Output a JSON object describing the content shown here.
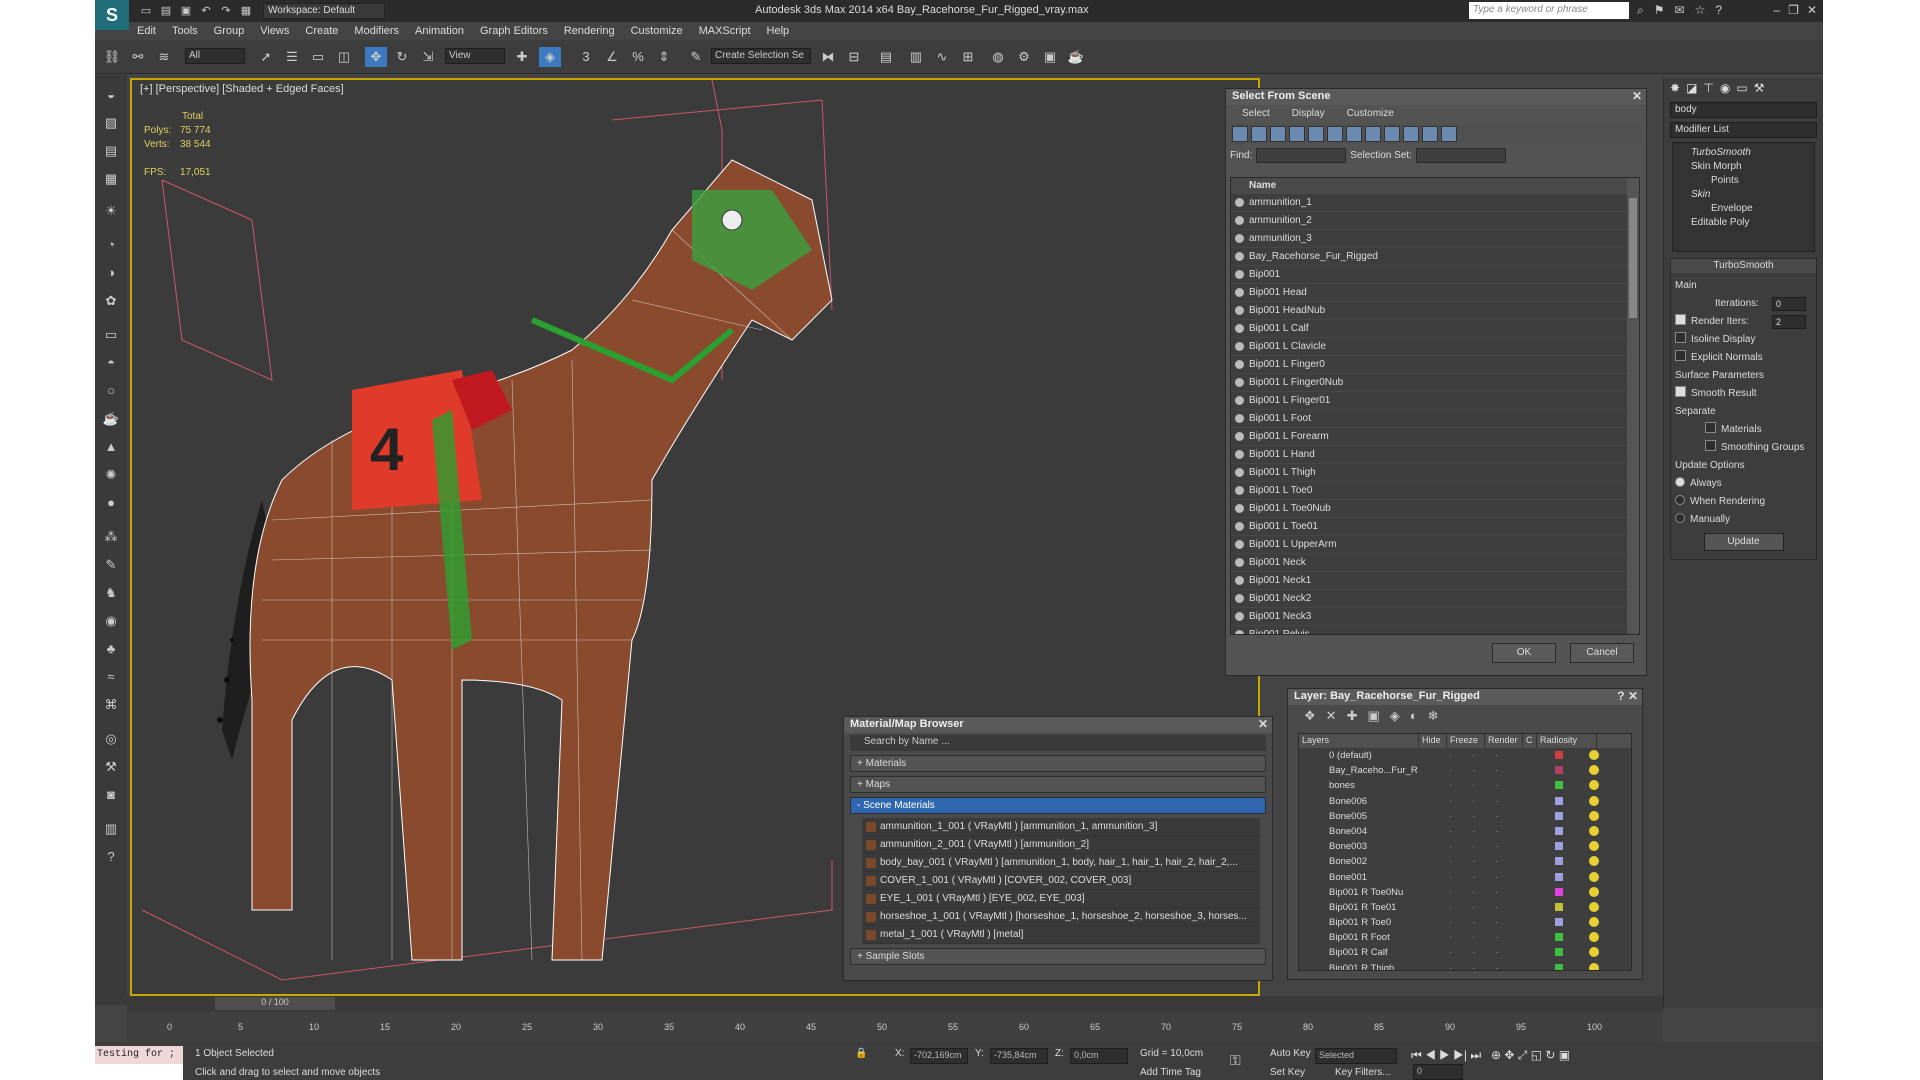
{
  "window": {
    "title": "Autodesk 3ds Max  2014 x64    Bay_Racehorse_Fur_Rigged_vray.max",
    "workspace": "Workspace: Default",
    "search_placeholder": "Type a keyword or phrase"
  },
  "menu": [
    "Edit",
    "Tools",
    "Group",
    "Views",
    "Create",
    "Modifiers",
    "Animation",
    "Graph Editors",
    "Rendering",
    "Customize",
    "MAXScript",
    "Help"
  ],
  "toolbar": {
    "filter": "All",
    "view": "View",
    "selset": "Create Selection Se"
  },
  "viewport": {
    "label": "[+] [Perspective] [Shaded + Edged Faces]",
    "stats": {
      "total": "Total",
      "polys_label": "Polys:",
      "polys": "75 774",
      "verts_label": "Verts:",
      "verts": "38 544",
      "fps_label": "FPS:",
      "fps": "17,051"
    },
    "number": "4"
  },
  "sfs": {
    "title": "Select From Scene",
    "menu": [
      "Select",
      "Display",
      "Customize"
    ],
    "find": "Find:",
    "selset": "Selection Set:",
    "col": "Name",
    "items": [
      "ammunition_1",
      "ammunition_2",
      "ammunition_3",
      "Bay_Racehorse_Fur_Rigged",
      "Bip001",
      "Bip001 Head",
      "Bip001 HeadNub",
      "Bip001 L Calf",
      "Bip001 L Clavicle",
      "Bip001 L Finger0",
      "Bip001 L Finger0Nub",
      "Bip001 L Finger01",
      "Bip001 L Foot",
      "Bip001 L Forearm",
      "Bip001 L Hand",
      "Bip001 L Thigh",
      "Bip001 L Toe0",
      "Bip001 L Toe0Nub",
      "Bip001 L Toe01",
      "Bip001 L UpperArm",
      "Bip001 Neck",
      "Bip001 Neck1",
      "Bip001 Neck2",
      "Bip001 Neck3",
      "Bip001 Pelvis"
    ],
    "ok": "OK",
    "cancel": "Cancel"
  },
  "mmb": {
    "title": "Material/Map Browser",
    "search": "Search by Name ...",
    "sections": [
      "+ Materials",
      "+ Maps",
      "- Scene Materials"
    ],
    "materials": [
      "ammunition_1_001  ( VRayMtl ) [ammunition_1, ammunition_3]",
      "ammunition_2_001  ( VRayMtl ) [ammunition_2]",
      "body_bay_001  ( VRayMtl ) [ammunition_1, body, hair_1, hair_1, hair_2, hair_2,...",
      "COVER_1_001  ( VRayMtl ) [COVER_002, COVER_003]",
      "EYE_1_001  ( VRayMtl ) [EYE_002, EYE_003]",
      "horseshoe_1_001  ( VRayMtl ) [horseshoe_1, horseshoe_2, horseshoe_3, horses...",
      "metal_1_001  ( VRayMtl ) [metal]"
    ],
    "sample": "+ Sample Slots"
  },
  "layer": {
    "title": "Layer: Bay_Racehorse_Fur_Rigged",
    "cols": [
      "Layers",
      "Hide",
      "Freeze",
      "Render",
      "C",
      "Radiosity"
    ],
    "rows": [
      {
        "n": "0 (default)",
        "c": "#d04040"
      },
      {
        "n": "Bay_Raceho...Fur_R",
        "c": "#b04060"
      },
      {
        "n": "bones",
        "c": "#40c040"
      },
      {
        "n": "Bone006",
        "c": "#a0a0e0"
      },
      {
        "n": "Bone005",
        "c": "#a0a0e0"
      },
      {
        "n": "Bone004",
        "c": "#a0a0e0"
      },
      {
        "n": "Bone003",
        "c": "#a0a0e0"
      },
      {
        "n": "Bone002",
        "c": "#a0a0e0"
      },
      {
        "n": "Bone001",
        "c": "#a0a0e0"
      },
      {
        "n": "Bip001 R Toe0Nu",
        "c": "#e040e0"
      },
      {
        "n": "Bip001 R Toe01",
        "c": "#c0c040"
      },
      {
        "n": "Bip001 R Toe0",
        "c": "#a0a0e0"
      },
      {
        "n": "Bip001 R Foot",
        "c": "#40c040"
      },
      {
        "n": "Bip001 R Calf",
        "c": "#40c040"
      },
      {
        "n": "Bip001 R Thigh",
        "c": "#40c040"
      }
    ]
  },
  "cmd": {
    "name": "body",
    "modlist": "Modifier List",
    "stack": [
      "TurboSmooth",
      "Skin Morph",
      "Points",
      "Skin",
      "Envelope",
      "Editable Poly"
    ],
    "ts": "TurboSmooth",
    "main": "Main",
    "iter_label": "Iterations:",
    "iter": "0",
    "render_label": "Render Iters:",
    "render": "2",
    "isoline": "Isoline Display",
    "explicit": "Explicit Normals",
    "surface": "Surface Parameters",
    "smooth": "Smooth Result",
    "separate": "Separate",
    "materials": "Materials",
    "groups": "Smoothing Groups",
    "upd": "Update Options",
    "always": "Always",
    "whenr": "When Rendering",
    "manual": "Manually",
    "update": "Update"
  },
  "time": {
    "frame": "0 / 100",
    "ticks": [
      "0",
      "5",
      "10",
      "15",
      "20",
      "25",
      "30",
      "35",
      "40",
      "45",
      "50",
      "55",
      "60",
      "65",
      "70",
      "75",
      "80",
      "85",
      "90",
      "95",
      "100"
    ]
  },
  "status": {
    "script1": "Testing for ;",
    "selected": "1 Object Selected",
    "hint": "Click and drag to select and move objects",
    "x": "-702,169cm",
    "y": "-735,84cm",
    "z": "0,0cm",
    "grid": "Grid = 10,0cm",
    "tag": "Add Time Tag",
    "autokey": "Auto Key",
    "setkey": "Set Key",
    "sel": "Selected",
    "keyf": "Key Filters...",
    "frame": "0"
  }
}
